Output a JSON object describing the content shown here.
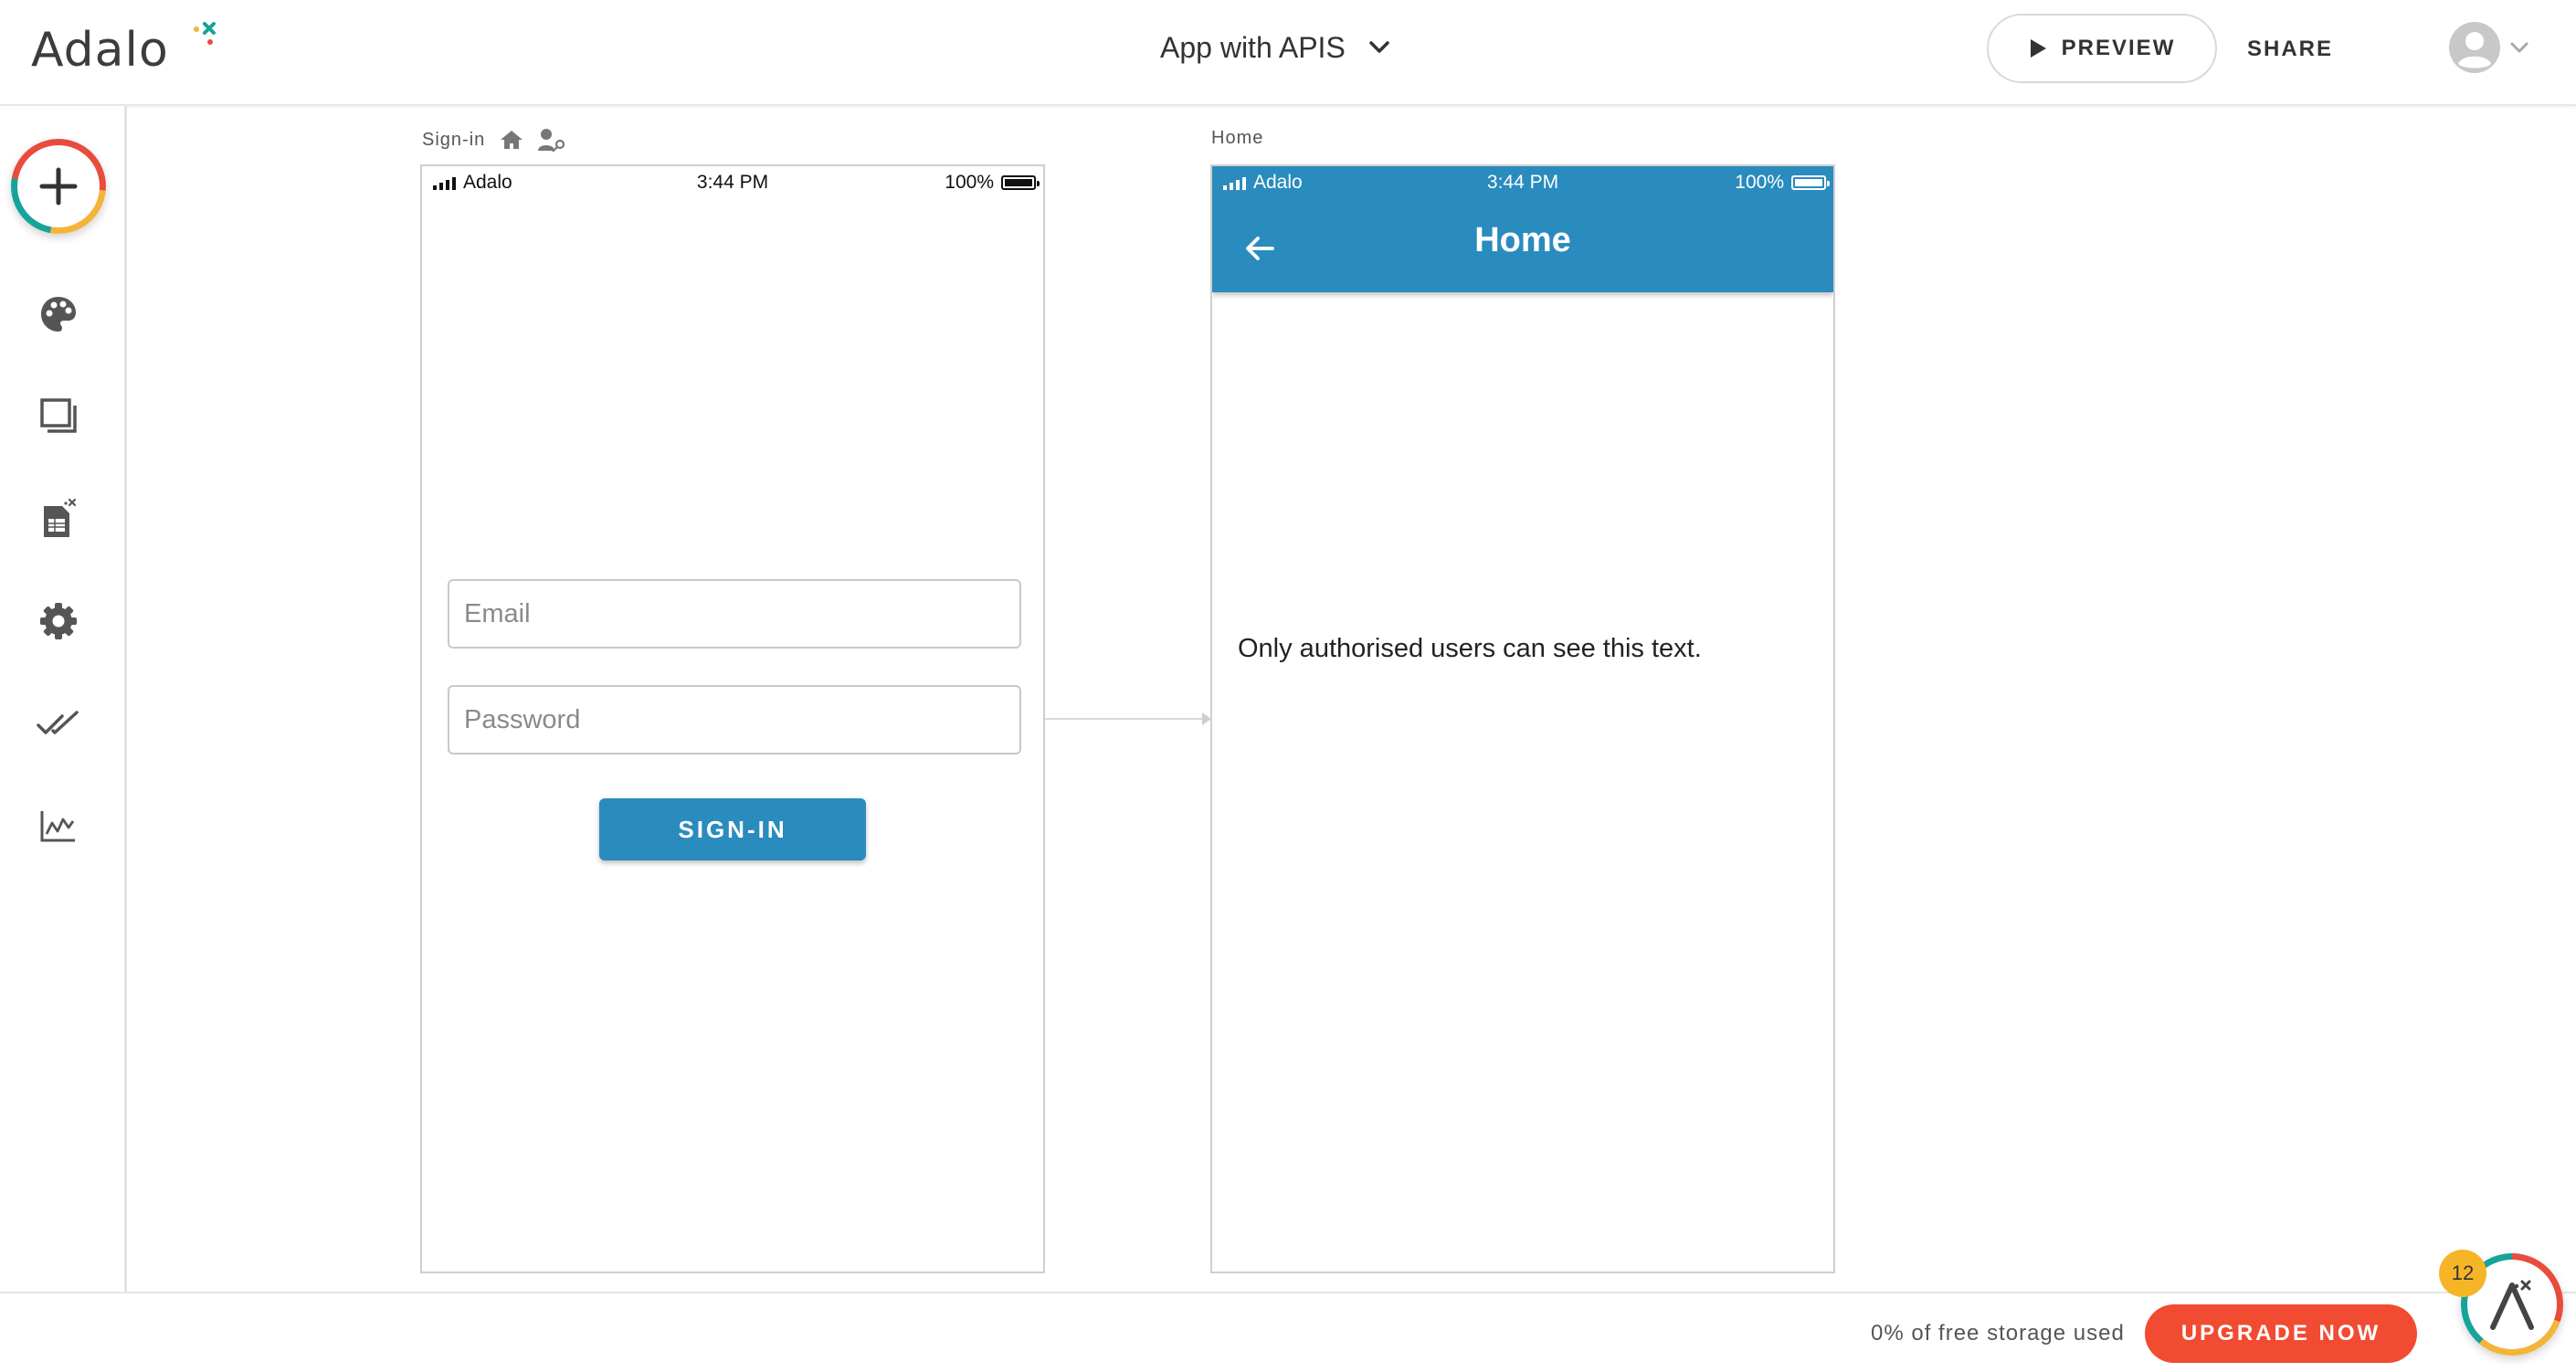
{
  "header": {
    "logo_text": "Adalo",
    "app_title": "App with APIS",
    "preview_label": "PREVIEW",
    "share_label": "SHARE"
  },
  "sidebar": {
    "items": [
      {
        "name": "add-component",
        "icon": "plus-icon"
      },
      {
        "name": "branding",
        "icon": "palette-icon"
      },
      {
        "name": "screens",
        "icon": "screens-icon"
      },
      {
        "name": "database",
        "icon": "database-icon"
      },
      {
        "name": "settings",
        "icon": "gear-icon"
      },
      {
        "name": "publish",
        "icon": "double-check-icon"
      },
      {
        "name": "analytics",
        "icon": "analytics-icon"
      }
    ]
  },
  "screens": {
    "signin": {
      "label": "Sign-in",
      "status": {
        "carrier": "Adalo",
        "time": "3:44 PM",
        "battery": "100%"
      },
      "email_placeholder": "Email",
      "password_placeholder": "Password",
      "button_label": "SIGN-IN"
    },
    "home": {
      "label": "Home",
      "status": {
        "carrier": "Adalo",
        "time": "3:44 PM",
        "battery": "100%"
      },
      "title": "Home",
      "body_text": "Only authorised users can see this text."
    }
  },
  "footer": {
    "storage_text": "0% of free storage used",
    "upgrade_label": "UPGRADE NOW",
    "notification_count": "12"
  },
  "colors": {
    "accent_blue": "#2a8bbe",
    "upgrade_red": "#f14b32",
    "badge_yellow": "#f6b527"
  }
}
